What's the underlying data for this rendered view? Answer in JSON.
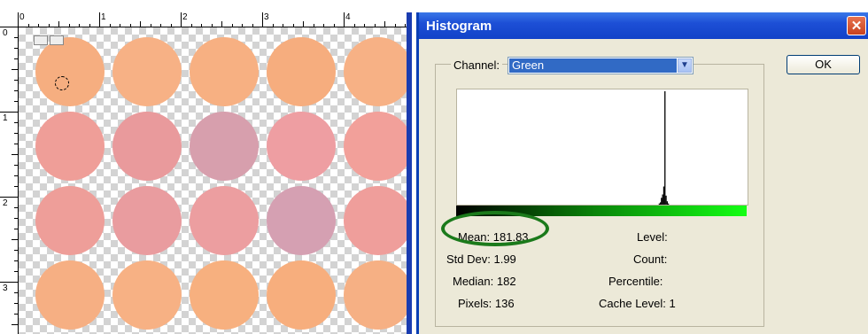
{
  "canvas": {
    "ruler_top_labels": [
      "0",
      "1",
      "2",
      "3",
      "4"
    ],
    "ruler_left_labels": [
      "0",
      "1",
      "2",
      "3"
    ],
    "swatch_colors": [
      [
        "#f6ae80",
        "#f7b185",
        "#f7b082",
        "#f6ad7e",
        "#f7b185"
      ],
      [
        "#ef9e98",
        "#e99a9c",
        "#d79fad",
        "#ee9ea2",
        "#f2a09a"
      ],
      [
        "#ee9e99",
        "#e99c9f",
        "#ec9ea0",
        "#d5a0b2",
        "#ef9e9b"
      ],
      [
        "#f6af83",
        "#f7b184",
        "#f7b07f",
        "#f7ae7d",
        "#f6b084"
      ]
    ]
  },
  "dialog": {
    "title": "Histogram",
    "close_icon": "close-icon",
    "ok_label": "OK",
    "channel_label": "Channel:",
    "channel_value": "Green",
    "stats": {
      "mean_label": "Mean:",
      "mean_value": "181.83",
      "std_label": "Std Dev:",
      "std_value": "1.99",
      "median_label": "Median:",
      "median_value": "182",
      "pixels_label": "Pixels:",
      "pixels_value": "136",
      "level_label": "Level:",
      "level_value": "",
      "count_label": "Count:",
      "count_value": "",
      "percentile_label": "Percentile:",
      "percentile_value": "",
      "cache_label": "Cache Level:",
      "cache_value": "1"
    },
    "highlight_color": "#1b7a1b"
  },
  "chart_data": {
    "type": "bar",
    "x": [
      177,
      178,
      179,
      180,
      181,
      182,
      183,
      184,
      185,
      186
    ],
    "values": [
      1,
      2,
      6,
      9,
      16,
      100,
      8,
      3,
      1,
      0
    ],
    "xlim": [
      0,
      255
    ],
    "ylim": [
      0,
      100
    ],
    "title": "",
    "xlabel": "",
    "ylabel": ""
  }
}
